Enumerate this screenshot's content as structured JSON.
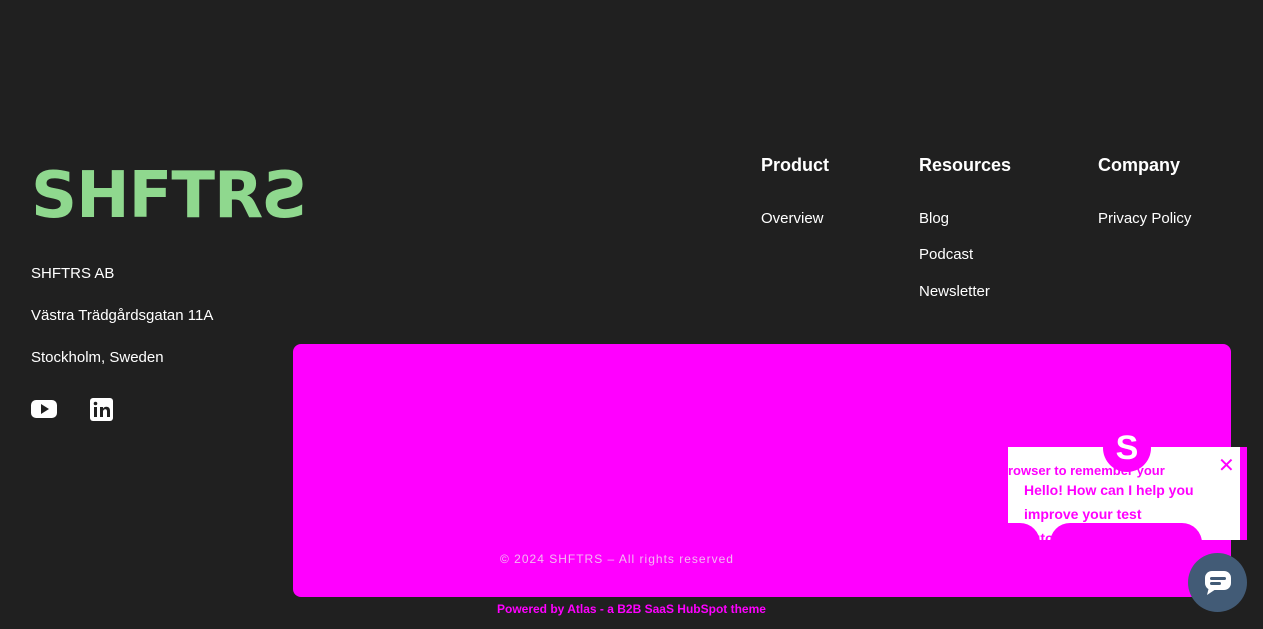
{
  "brand": {
    "logo_main": "SHFTR",
    "logo_last": "S"
  },
  "address": {
    "company": "SHFTRS AB",
    "street": "Västra Trädgårdsgatan 11A",
    "city": "Stockholm, Sweden"
  },
  "social": [
    {
      "icon": "youtube-icon"
    },
    {
      "icon": "linkedin-icon"
    }
  ],
  "footer_columns": [
    {
      "title": "Product",
      "links": [
        "Overview"
      ]
    },
    {
      "title": "Resources",
      "links": [
        "Blog",
        "Podcast",
        "Newsletter"
      ]
    },
    {
      "title": "Company",
      "links": [
        "Privacy Policy"
      ]
    }
  ],
  "copyright": "© 2024 SHFTRS – All rights reserved",
  "powered_by": "Powered by Atlas - a B2B SaaS HubSpot theme",
  "chat": {
    "avatar_letter": "S",
    "partial_text": "rowser to remember your",
    "greeting": "Hello! How can I help you improve your test automation?",
    "close_label": "✕"
  },
  "colors": {
    "background": "#202020",
    "logo": "#8fd88e",
    "overlay": "#ff00ff",
    "launcher": "#425b76"
  }
}
